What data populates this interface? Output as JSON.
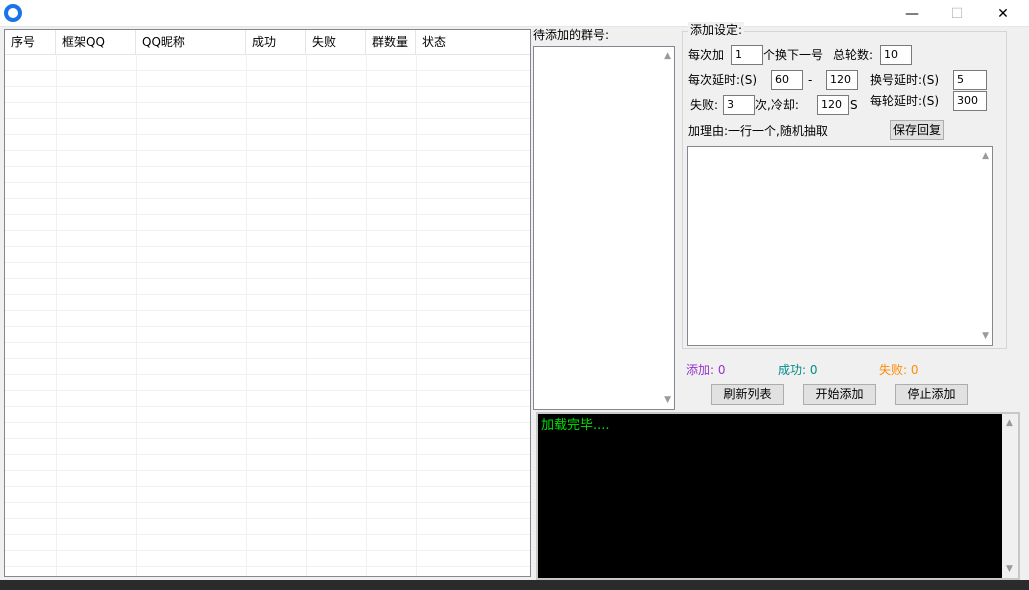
{
  "window": {
    "minimize_glyph": "—",
    "maximize_glyph": "☐",
    "close_glyph": "✕"
  },
  "listview": {
    "columns": [
      "序号",
      "框架QQ",
      "QQ昵称",
      "成功",
      "失败",
      "群数量",
      "状态"
    ]
  },
  "pending": {
    "label": "待添加的群号:"
  },
  "settings": {
    "legend": "添加设定:",
    "per_add_label": "每次加",
    "per_add_value": "1",
    "switch_label": "个换下一号",
    "total_rounds_label": "总轮数:",
    "total_rounds_value": "10",
    "delay_label": "每次延时:(S)",
    "delay_min": "60",
    "delay_dash": "-",
    "delay_max": "120",
    "switch_delay_label": "换号延时:(S)",
    "switch_delay_value": "5",
    "fail_label": "失败:",
    "fail_value": "3",
    "cooldown_label": "次,冷却:",
    "cooldown_value": "120",
    "cooldown_unit": "S",
    "round_delay_label": "每轮延时:(S)",
    "round_delay_value": "300",
    "reason_label": "加理由:一行一个,随机抽取",
    "save_reply_button": "保存回复"
  },
  "stats": {
    "added_label": "添加: 0",
    "success_label": "成功: 0",
    "failed_label": "失败: 0"
  },
  "actions": {
    "refresh": "刷新列表",
    "start": "开始添加",
    "stop": "停止添加"
  },
  "log": {
    "text": "加载完毕...."
  },
  "colors": {
    "added": "#9932cc",
    "success": "#008b8b",
    "failed": "#ff8c00",
    "log_text": "#00e000",
    "app_icon": "#1a73e8"
  }
}
